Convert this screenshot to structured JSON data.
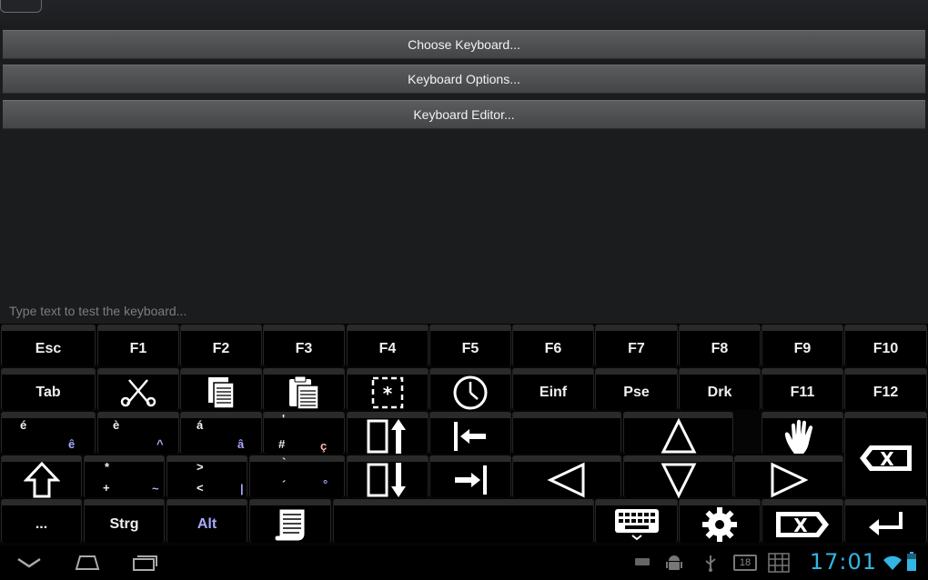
{
  "menu": {
    "choose": "Choose Keyboard...",
    "options": "Keyboard Options...",
    "editor": "Keyboard Editor..."
  },
  "test_field": {
    "placeholder": "Type text to test the keyboard..."
  },
  "keyboard": {
    "row1": [
      "Esc",
      "F1",
      "F2",
      "F3",
      "F4",
      "F5",
      "F6",
      "F7",
      "F8",
      "F9",
      "F10"
    ],
    "row2": {
      "tab": "Tab",
      "einf": "Einf",
      "pse": "Pse",
      "drk": "Drk",
      "f11": "F11",
      "f12": "F12"
    },
    "row3": {
      "k1": {
        "top": "é",
        "bottom": "ê"
      },
      "k2": {
        "top": "è",
        "bottom": "^"
      },
      "k3": {
        "top": "á",
        "bottom": "â"
      },
      "k4": {
        "top": "'",
        "mid": "#",
        "bottom": "ç"
      }
    },
    "row4": {
      "k1": {
        "top": "*",
        "mid": "+",
        "bottom": "~"
      },
      "k2": {
        "top": ">",
        "mid": "<",
        "bottom": "|"
      },
      "k3": {
        "top": "`",
        "mid": "´",
        "bottom": "°"
      }
    },
    "row5": {
      "dots": "...",
      "strg": "Strg",
      "alt": "Alt"
    }
  },
  "status": {
    "clock": "17:01",
    "notification_count": "18"
  },
  "colors": {
    "accent": "#33b5e5",
    "alt_key": "#a9a9ff",
    "background": "#1b1c1e"
  }
}
